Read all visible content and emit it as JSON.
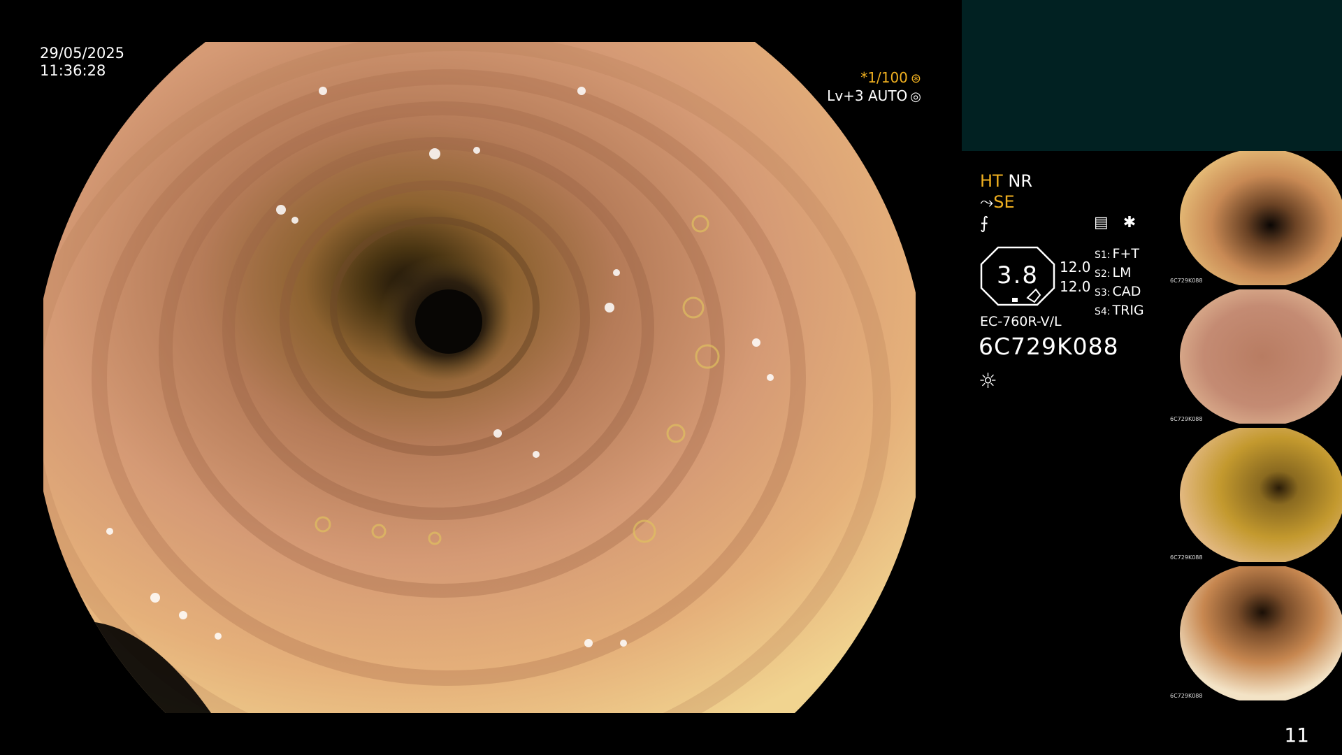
{
  "datetime": {
    "date": "29/05/2025",
    "time": "11:36:28"
  },
  "capture": {
    "shutter": "*1/100",
    "level": "Lv+3",
    "mode": "AUTO"
  },
  "status": {
    "ht": "HT",
    "nr": "NR",
    "se": "SE"
  },
  "gauge": {
    "value": "3.8",
    "upper": "12.0",
    "lower": "12.0"
  },
  "settings": [
    {
      "key": "S1:",
      "val": "F+T"
    },
    {
      "key": "S2:",
      "val": "LM"
    },
    {
      "key": "S3:",
      "val": "CAD"
    },
    {
      "key": "S4:",
      "val": "TRIG"
    }
  ],
  "scope": {
    "model": "EC-760R-V/L",
    "serial": "6C729K088"
  },
  "thumbnails": [
    {
      "id": "6C729K088",
      "tone": "#c98a55"
    },
    {
      "id": "6C729K088",
      "tone": "#c48b73"
    },
    {
      "id": "6C729K088",
      "tone": "#c3992e"
    },
    {
      "id": "6C729K088",
      "tone": "#c78750"
    }
  ],
  "page": {
    "number": "11"
  },
  "colors": {
    "accent": "#f0b020",
    "panel": "#012122",
    "mucosa": "#c98c6a"
  }
}
